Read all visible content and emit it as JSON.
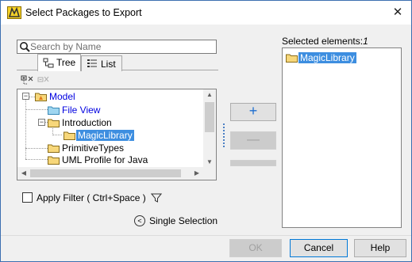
{
  "window": {
    "title": "Select Packages to Export",
    "close_glyph": "✕",
    "app_icon": "magicdraw-app-icon"
  },
  "search": {
    "placeholder": "Search by Name",
    "value": ""
  },
  "tabs": [
    {
      "label": "Tree",
      "icon": "tree-view-icon",
      "active": true
    },
    {
      "label": "List",
      "icon": "list-view-icon",
      "active": false
    }
  ],
  "toolbar": {
    "expand_icon": "expand-all-icon",
    "collapse_icon": "collapse-all-icon"
  },
  "tree": {
    "nodes": [
      {
        "label": "Model",
        "icon": "model-folder-icon",
        "expander": "−",
        "style": "link"
      },
      {
        "label": "File View",
        "icon": "file-view-folder-icon",
        "style": "link"
      },
      {
        "label": "Introduction",
        "icon": "folder-icon",
        "expander": "−"
      },
      {
        "label": "MagicLibrary",
        "icon": "folder-icon",
        "selected": true
      },
      {
        "label": "PrimitiveTypes",
        "icon": "folder-icon"
      },
      {
        "label": "UML Profile for Java",
        "icon": "folder-icon"
      }
    ]
  },
  "filter": {
    "label": "Apply Filter ( Ctrl+Space )",
    "checked": false,
    "icon": "funnel-icon"
  },
  "single_selection": {
    "label": "Single Selection",
    "icon": "chevron-left-circle-icon",
    "glyph": "<"
  },
  "transfer": {
    "add_glyph": "+",
    "remove_glyph": "—"
  },
  "selected": {
    "label": "Selected elements:",
    "count": "1",
    "items": [
      {
        "label": "MagicLibrary",
        "icon": "folder-icon"
      }
    ]
  },
  "buttons": {
    "ok": "OK",
    "cancel": "Cancel",
    "help": "Help"
  },
  "colors": {
    "accent": "#0078d7",
    "selection": "#3d8ee0",
    "link": "#0000e0",
    "folder": "#f7d77a"
  }
}
